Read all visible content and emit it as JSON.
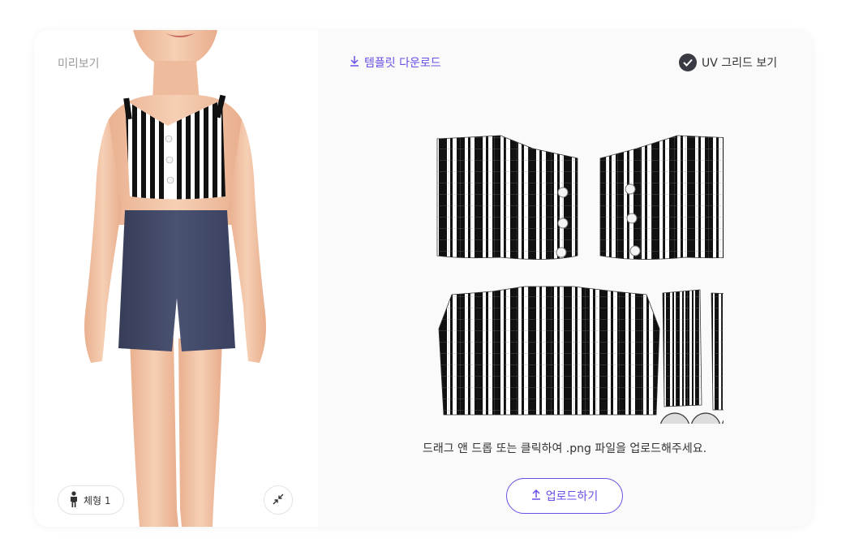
{
  "preview": {
    "label": "미리보기",
    "body_type_label": "체형 1",
    "icons": {
      "body": "person-icon",
      "collapse": "collapse-arrows-icon"
    }
  },
  "template": {
    "download_label": "템플릿 다운로드",
    "uv_grid_label": "UV 그리드 보기",
    "uv_grid_checked": true,
    "drop_hint": "드래그 앤 드롭 또는 클릭하여 .png 파일을 업로드해주세요.",
    "upload_label": "업로드하기",
    "icons": {
      "download": "download-icon",
      "check": "check-icon",
      "upload": "upload-icon"
    }
  },
  "colors": {
    "accent": "#6a4ee6",
    "skin": "#f2c4a6",
    "shorts": "#434a66"
  }
}
